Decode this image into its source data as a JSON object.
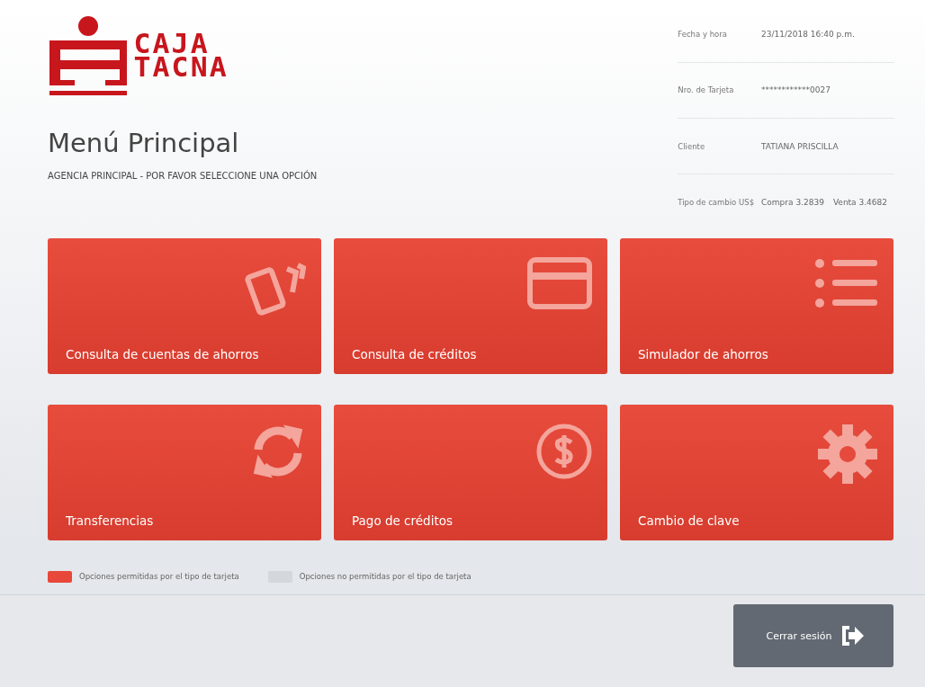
{
  "logo": {
    "line_1": "CAJA",
    "line_2": "TACNA"
  },
  "info": [
    {
      "label": "Fecha y hora",
      "values": [
        "23/11/2018  16:40  p.m."
      ]
    },
    {
      "label": "Nro. de Tarjeta",
      "values": [
        "************0027"
      ]
    },
    {
      "label": "Cliente",
      "values": [
        "TATIANA PRISCILLA"
      ]
    },
    {
      "label": "Tipo de cambio US$",
      "values": [
        "Compra  3.2839",
        "Venta  3.4682"
      ]
    }
  ],
  "title": "Menú Principal",
  "subtitle": "AGENCIA PRINCIPAL - POR FAVOR SELECCIONE UNA OPCIÓN",
  "options": [
    {
      "label": "Consulta de cuentas de ahorros",
      "kind": "cards",
      "allowed": true
    },
    {
      "label": "Consulta de créditos",
      "kind": "card",
      "allowed": true
    },
    {
      "label": "Simulador de ahorros",
      "kind": "list",
      "allowed": true
    },
    {
      "label": "Transferencias",
      "kind": "sync",
      "allowed": true
    },
    {
      "label": "Pago de créditos",
      "kind": "coin",
      "allowed": true
    },
    {
      "label": "Cambio de clave",
      "kind": "gear",
      "allowed": true
    }
  ],
  "legend": [
    {
      "label": "Opciones permitidas por el tipo de tarjeta",
      "color": "#e8483a"
    },
    {
      "label": "Opciones no permitidas por el tipo de tarjeta",
      "color": "#d4d7db"
    }
  ],
  "logout_button": "Cerrar sesión"
}
